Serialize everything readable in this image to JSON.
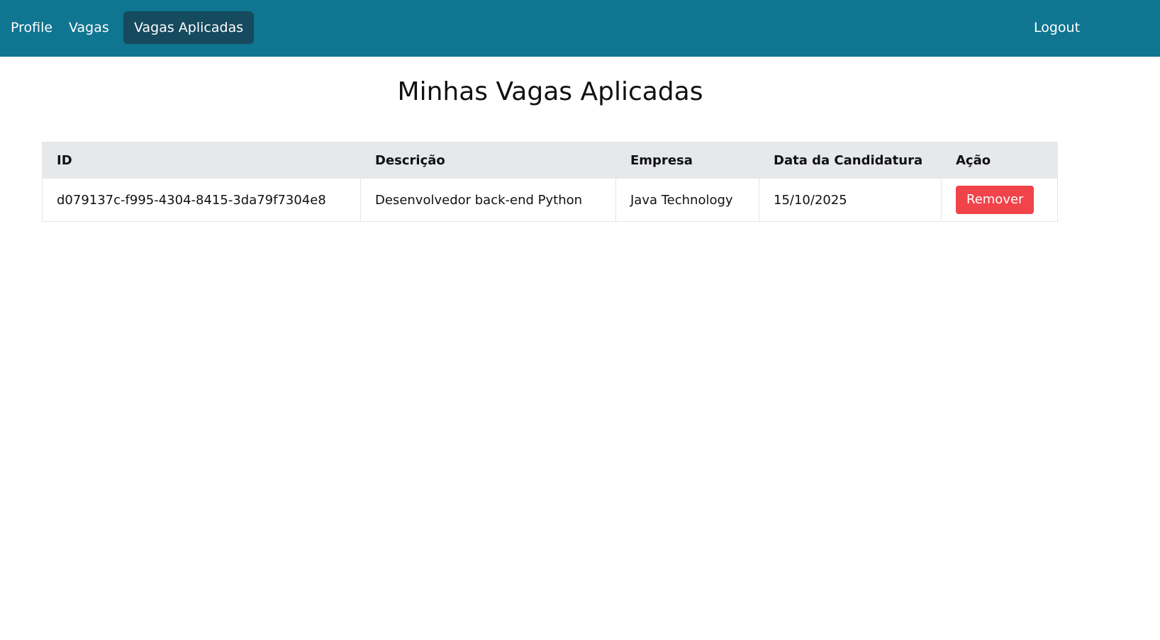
{
  "navbar": {
    "items": [
      {
        "label": "Profile"
      },
      {
        "label": "Vagas"
      },
      {
        "label": "Vagas Aplicadas",
        "active": true
      }
    ],
    "logout_label": "Logout",
    "background_color": "#0f7591",
    "active_color": "#164a5e"
  },
  "page": {
    "title": "Minhas Vagas Aplicadas"
  },
  "table": {
    "headers": [
      "ID",
      "Descrição",
      "Empresa",
      "Data da Candidatura",
      "Ação"
    ],
    "rows": [
      {
        "id": "d079137c-f995-4304-8415-3da79f7304e8",
        "descricao": "Desenvolvedor back-end Python",
        "empresa": "Java Technology",
        "data": "15/10/2025",
        "action_label": "Remover"
      }
    ],
    "action_color": "#f0434a"
  }
}
